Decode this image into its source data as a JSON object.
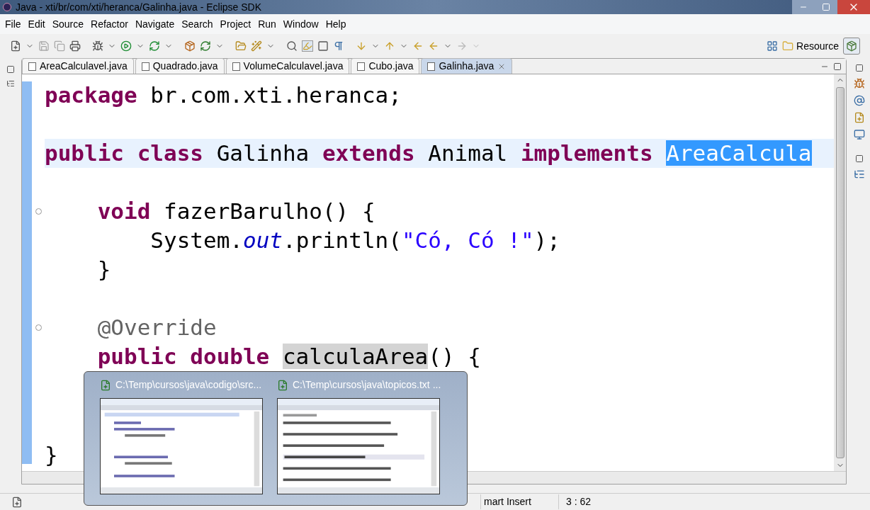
{
  "window": {
    "title": "Java - xti/br/com/xti/heranca/Galinha.java - Eclipse SDK"
  },
  "menu": [
    "File",
    "Edit",
    "Source",
    "Refactor",
    "Navigate",
    "Search",
    "Project",
    "Run",
    "Window",
    "Help"
  ],
  "perspective": {
    "label": "Resource"
  },
  "editor": {
    "tabs": [
      {
        "label": "AreaCalculavel.java",
        "selected": false
      },
      {
        "label": "Quadrado.java",
        "selected": false
      },
      {
        "label": "VolumeCalculavel.java",
        "selected": false
      },
      {
        "label": "Cubo.java",
        "selected": false
      },
      {
        "label": "Galinha.java",
        "selected": true
      }
    ],
    "lines": [
      {
        "current": false,
        "foldable": false,
        "tokens": [
          {
            "kind": "keyword",
            "text": "package"
          },
          {
            "kind": "plain",
            "text": " br.com.xti.heranca;"
          }
        ]
      },
      {
        "current": false,
        "foldable": false
      },
      {
        "current": true,
        "foldable": false,
        "tokens": [
          {
            "kind": "keyword",
            "text": "public"
          },
          {
            "kind": "keyword",
            "text": " class"
          },
          {
            "kind": "plain",
            "text": " Galinha "
          },
          {
            "kind": "keyword",
            "text": "extends"
          },
          {
            "kind": "plain",
            "text": " Animal "
          },
          {
            "kind": "keyword",
            "text": "implements "
          },
          {
            "kind": "selection",
            "text": "AreaCalcula"
          }
        ]
      },
      {
        "current": false,
        "foldable": false
      },
      {
        "current": false,
        "foldable": true,
        "tokens": [
          {
            "kind": "keyword",
            "text": "    void"
          },
          {
            "kind": "plain",
            "text": " fazerBarulho() {"
          }
        ]
      },
      {
        "current": false,
        "foldable": false,
        "tokens": [
          {
            "kind": "plain",
            "text": "        System."
          },
          {
            "kind": "field",
            "text": "out"
          },
          {
            "kind": "plain",
            "text": ".println("
          },
          {
            "kind": "string",
            "text": "\"Có, Có !\""
          },
          {
            "kind": "plain",
            "text": ");"
          }
        ]
      },
      {
        "current": false,
        "foldable": false,
        "tokens": [
          {
            "kind": "plain",
            "text": "    }"
          }
        ]
      },
      {
        "current": false,
        "foldable": false
      },
      {
        "current": false,
        "foldable": true,
        "tokens": [
          {
            "kind": "annotation",
            "text": "    @Override"
          }
        ]
      },
      {
        "current": false,
        "foldable": false,
        "tokens": [
          {
            "kind": "keyword",
            "text": "    public"
          },
          {
            "kind": "keyword",
            "text": " double "
          },
          {
            "kind": "occurrence",
            "text": "calculaArea"
          },
          {
            "kind": "plain",
            "text": "() {"
          }
        ]
      }
    ],
    "last_line": {
      "tokens": [
        {
          "kind": "plain",
          "text": "}"
        }
      ]
    }
  },
  "taskbar_preview": {
    "windows": [
      {
        "title": "C:\\Temp\\cursos\\java\\codigo\\src..."
      },
      {
        "title": "C:\\Temp\\cursos\\java\\topicos.txt ..."
      }
    ]
  },
  "status_bar": {
    "insert_mode": "mart Insert",
    "position": "3 : 62"
  }
}
